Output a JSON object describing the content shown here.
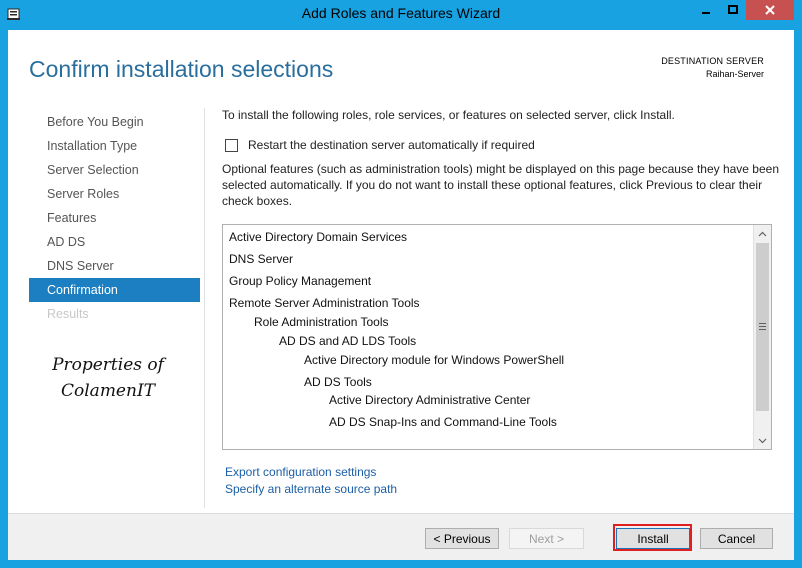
{
  "window": {
    "title": "Add Roles and Features Wizard"
  },
  "header": {
    "page_title": "Confirm installation selections",
    "destination_label": "DESTINATION SERVER",
    "destination_value": "Raihan-Server"
  },
  "nav": {
    "items": [
      {
        "label": "Before You Begin",
        "state": "normal"
      },
      {
        "label": "Installation Type",
        "state": "normal"
      },
      {
        "label": "Server Selection",
        "state": "normal"
      },
      {
        "label": "Server Roles",
        "state": "normal"
      },
      {
        "label": "Features",
        "state": "normal"
      },
      {
        "label": "AD DS",
        "state": "normal"
      },
      {
        "label": "DNS Server",
        "state": "normal"
      },
      {
        "label": "Confirmation",
        "state": "active"
      },
      {
        "label": "Results",
        "state": "disabled"
      }
    ]
  },
  "watermark": {
    "line1": "Properties of",
    "line2": "ColamenIT"
  },
  "content": {
    "intro": "To install the following roles, role services, or features on selected server, click Install.",
    "restart_label": "Restart the destination server automatically if required",
    "restart_checked": false,
    "optional_text": "Optional features (such as administration tools) might be displayed on this page because they have been selected automatically. If you do not want to install these optional features, click Previous to clear their check boxes."
  },
  "selections": [
    {
      "label": "Active Directory Domain Services",
      "level": 0
    },
    {
      "label": "DNS Server",
      "level": 0
    },
    {
      "label": "Group Policy Management",
      "level": 0
    },
    {
      "label": "Remote Server Administration Tools",
      "level": 0
    },
    {
      "label": "Role Administration Tools",
      "level": 1
    },
    {
      "label": "AD DS and AD LDS Tools",
      "level": 2
    },
    {
      "label": "Active Directory module for Windows PowerShell",
      "level": 3
    },
    {
      "label": "AD DS Tools",
      "level": 3
    },
    {
      "label": "Active Directory Administrative Center",
      "level": 4
    },
    {
      "label": "AD DS Snap-Ins and Command-Line Tools",
      "level": 4
    }
  ],
  "links": {
    "export": "Export configuration settings",
    "alternate_source": "Specify an alternate source path"
  },
  "buttons": {
    "previous": "< Previous",
    "next": "Next >",
    "install": "Install",
    "cancel": "Cancel"
  },
  "colors": {
    "frame": "#18a2e2",
    "accent": "#1c7fc2",
    "title": "#2a6e9e",
    "close": "#c75050",
    "highlight": "#e01f1f"
  }
}
